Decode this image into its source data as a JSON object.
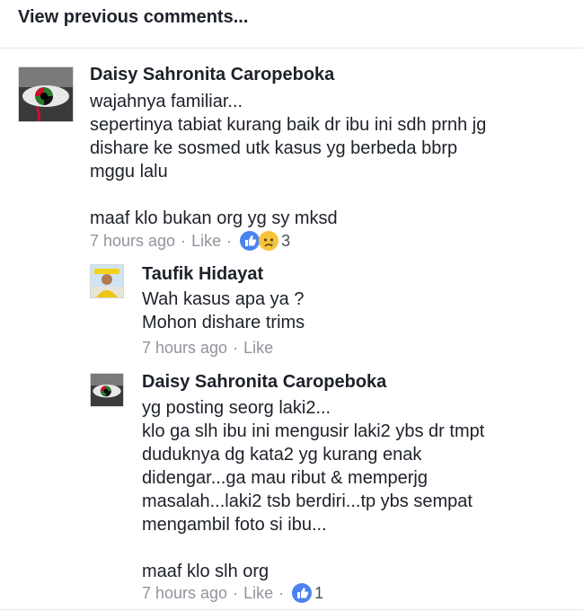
{
  "view_previous": "View previous comments...",
  "comments": [
    {
      "author": "Daisy Sahronita Caropeboka",
      "text": "wajahnya familiar...\nsepertinya tabiat kurang baik dr ibu ini sdh prnh jg\ndishare ke sosmed utk kasus yg berbeda bbrp\nmggu lalu\n\nmaaf klo bukan org yg sy mksd",
      "time": "7 hours ago",
      "like_label": "Like",
      "reactions": [
        "like-icon",
        "sad-icon"
      ],
      "reaction_count": "3",
      "avatar_icon": "eye-avatar"
    },
    {
      "author": "Taufik Hidayat",
      "text": "Wah kasus apa ya ?\nMohon dishare trims",
      "time": "7 hours ago",
      "like_label": "Like",
      "avatar_icon": "person-avatar"
    },
    {
      "author": "Daisy Sahronita Caropeboka",
      "text": "yg posting seorg laki2...\nklo ga slh ibu ini mengusir laki2 ybs dr tmpt\nduduknya dg kata2 yg kurang enak\ndidengar...ga mau ribut & memperjg\nmasalah...laki2 tsb berdiri...tp ybs sempat\nmengambil foto si ibu...\n\nmaaf klo slh org",
      "time": "7 hours ago",
      "like_label": "Like",
      "reactions": [
        "like-icon"
      ],
      "reaction_count": "1",
      "avatar_icon": "eye-avatar"
    }
  ],
  "colors": {
    "like_blue": "#4a83f0",
    "sad_yellow": "#f7c33a",
    "meta_gray": "#90949c"
  }
}
